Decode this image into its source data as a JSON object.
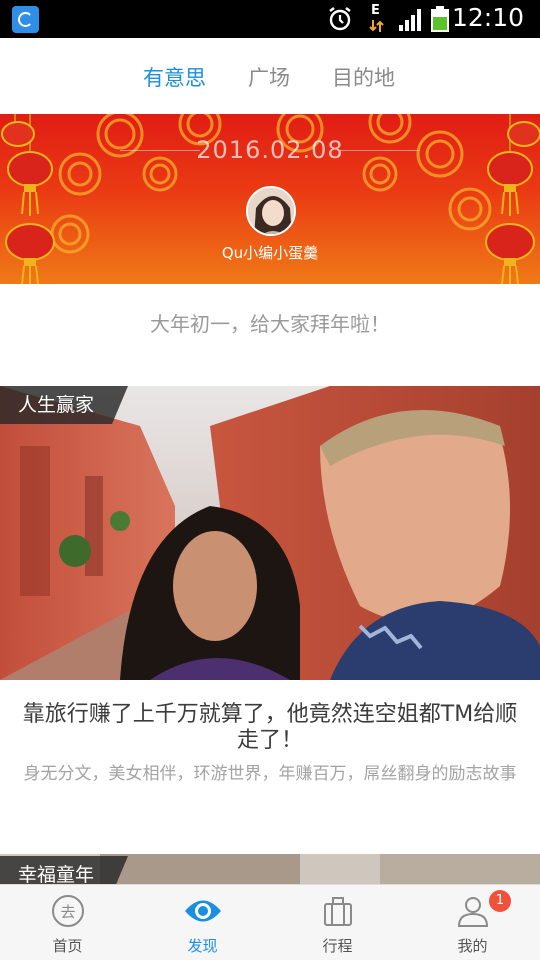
{
  "status_bar": {
    "time": "12:10",
    "network_type": "E",
    "icons": [
      "app-notification-icon",
      "alarm-icon",
      "data-transfer-icon",
      "signal-icon",
      "battery-icon"
    ]
  },
  "top_nav": {
    "tabs": [
      {
        "label": "有意思",
        "active": true
      },
      {
        "label": "广场",
        "active": false
      },
      {
        "label": "目的地",
        "active": false
      }
    ]
  },
  "banner": {
    "date": "2016.02.08",
    "username": "Qu小编小蛋羹"
  },
  "greeting": "大年初一，给大家拜年啦！",
  "cards": [
    {
      "tag": "人生赢家",
      "title": "靠旅行赚了上千万就算了，他竟然连空姐都TM给顺走了！",
      "description": "身无分文，美女相伴，环游世界，年赚百万，屌丝翻身的励志故事"
    },
    {
      "tag": "幸福童年"
    }
  ],
  "bottom_nav": {
    "items": [
      {
        "label": "首页",
        "icon": "go-icon",
        "active": false
      },
      {
        "label": "发现",
        "icon": "eye-icon",
        "active": true
      },
      {
        "label": "行程",
        "icon": "luggage-icon",
        "active": false
      },
      {
        "label": "我的",
        "icon": "user-icon",
        "active": false,
        "badge": "1"
      }
    ]
  },
  "colors": {
    "accent": "#1a8fe0",
    "banner_red": "#e11d14",
    "badge": "#f0513a"
  }
}
